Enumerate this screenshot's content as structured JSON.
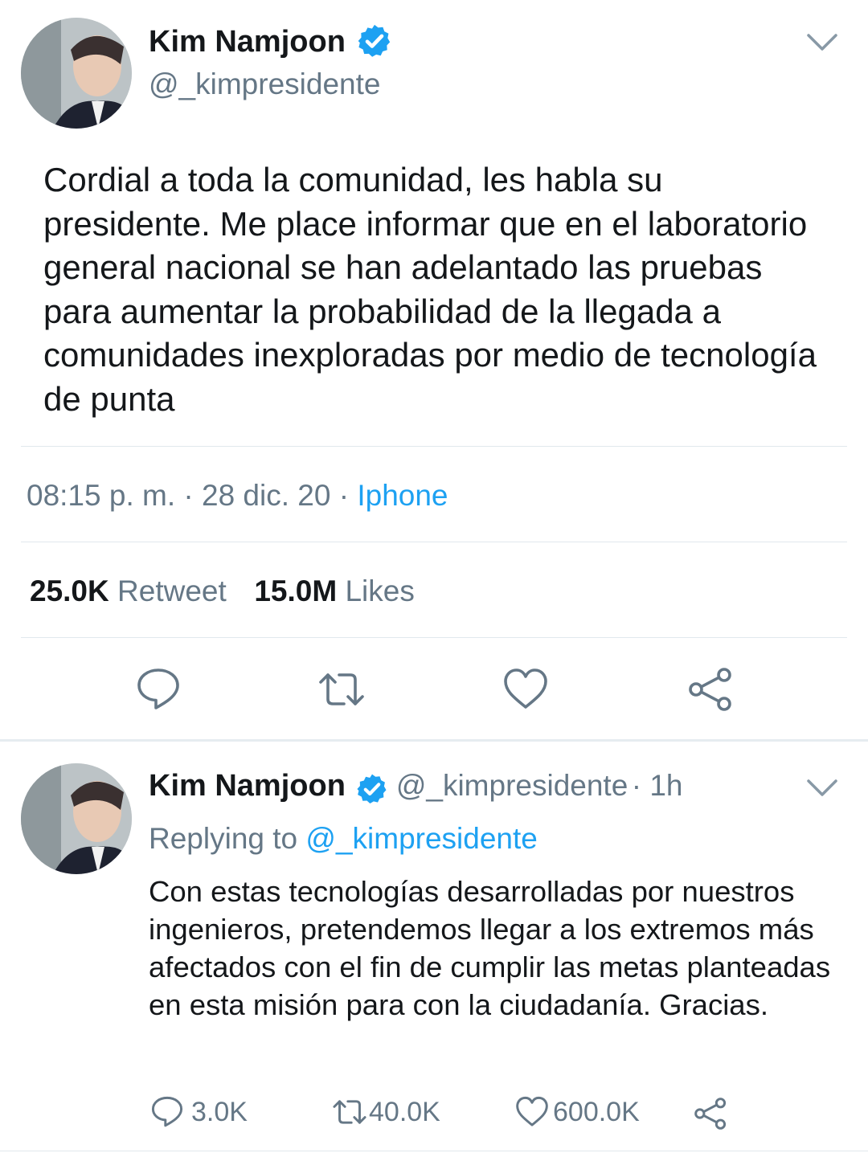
{
  "main_tweet": {
    "author_name": "Kim Namjoon",
    "author_handle": "@_kimpresidente",
    "text": "Cordial a toda la comunidad, les habla su presidente. Me place informar que en el laboratorio general nacional se han adelantado las pruebas para aumentar la probabilidad de la llegada a comunidades inexploradas por medio de tecnología de punta",
    "time": "08:15 p. m.",
    "separator": "·",
    "date": "28 dic. 20",
    "source": "Iphone",
    "retweets_count": "25.0K",
    "retweets_label": "Retweet",
    "likes_count": "15.0M",
    "likes_label": "Likes"
  },
  "reply_tweet": {
    "author_name": "Kim Namjoon",
    "author_handle": "@_kimpresidente",
    "age": "· 1h",
    "replying_prefix": "Replying to",
    "replying_handle": "@_kimpresidente",
    "text": "Con estas tecnologías desarrolladas por nuestros ingenieros, pretendemos llegar a los extremos más afectados con el fin de cumplir las metas planteadas en esta misión  para con la ciudadanía. Gracias.",
    "reply_count": "3.0K",
    "retweet_count": "40.0K",
    "like_count": "600.0K"
  },
  "colors": {
    "accent": "#1da1f2",
    "text_secondary": "#657786",
    "divider": "#e1e8ed"
  },
  "icons": [
    "verified-badge-icon",
    "chevron-down-icon",
    "reply-icon",
    "retweet-icon",
    "like-icon",
    "share-icon"
  ]
}
